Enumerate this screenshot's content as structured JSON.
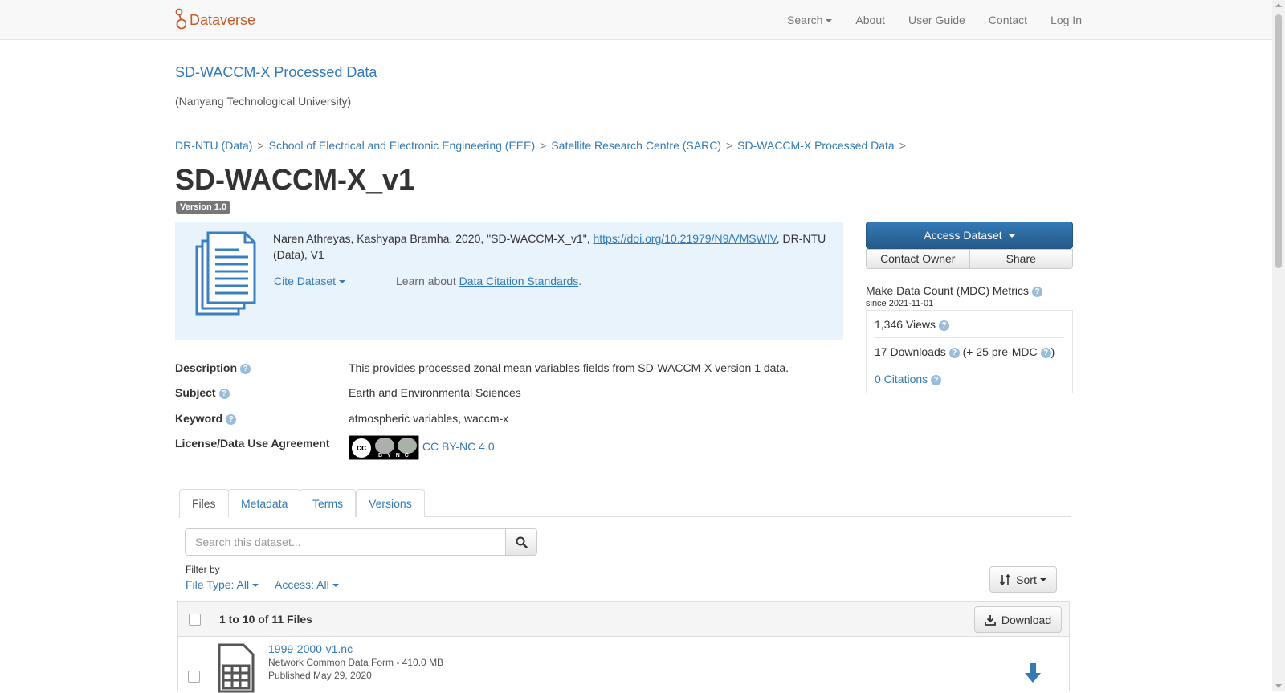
{
  "nav": {
    "brand": "Dataverse",
    "search": "Search",
    "about": "About",
    "user_guide": "User Guide",
    "contact": "Contact",
    "login": "Log In"
  },
  "dataverse": {
    "title": "SD-WACCM-X Processed Data",
    "affiliation": "(Nanyang Technological University)"
  },
  "breadcrumb": [
    "DR-NTU (Data)",
    "School of Electrical and Electronic Engineering (EEE)",
    "Satellite Research Centre (SARC)",
    "SD-WACCM-X Processed Data"
  ],
  "dataset": {
    "title": "SD-WACCM-X_v1",
    "version": "Version 1.0",
    "citation_pre": "Naren Athreyas, Kashyapa Bramha, 2020, \"SD-WACCM-X_v1\", ",
    "citation_doi": "https://doi.org/10.21979/N9/VMSWIV",
    "citation_post": ", DR-NTU (Data), V1",
    "cite_dataset": "Cite Dataset",
    "learn_about": "Learn about ",
    "citation_standards": "Data Citation Standards",
    "period": "."
  },
  "metadata": {
    "description_label": "Description",
    "description_value": "This provides processed zonal mean variables fields from SD-WACCM-X version 1 data.",
    "subject_label": "Subject",
    "subject_value": "Earth and Environmental Sciences",
    "keyword_label": "Keyword",
    "keyword_value": "atmospheric variables, waccm-x",
    "license_label": "License/Data Use Agreement",
    "license_value": "CC BY-NC 4.0"
  },
  "actions": {
    "access_dataset": "Access Dataset",
    "contact_owner": "Contact Owner",
    "share": "Share"
  },
  "mdc": {
    "title": "Make Data Count (MDC) Metrics",
    "since": "since 2021-11-01",
    "views": "1,346 Views",
    "downloads": "17 Downloads",
    "pre_mdc": "(+ 25 pre-MDC",
    "close_paren": ")",
    "citations": "0 Citations"
  },
  "tabs": [
    "Files",
    "Metadata",
    "Terms",
    "Versions"
  ],
  "files": {
    "search_placeholder": "Search this dataset...",
    "filter_by": "Filter by",
    "file_type": "File Type: All",
    "access": "Access: All",
    "sort": "Sort",
    "count": "1 to 10 of 11 Files",
    "download": "Download",
    "rows": [
      {
        "name": "1999-2000-v1.nc",
        "type": "Network Common Data Form - 410.0 MB",
        "published": "Published May 29, 2020"
      }
    ]
  },
  "colors": {
    "brand": "#c55b28",
    "link": "#337ab7",
    "primary_button": "#2e6da4",
    "citation_bg": "#e9f3fb"
  }
}
